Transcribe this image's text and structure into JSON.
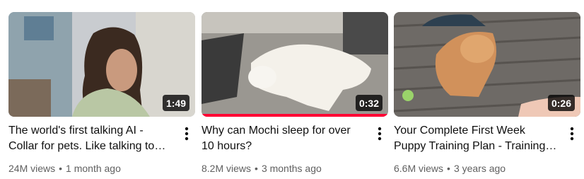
{
  "videos": [
    {
      "title": "The world's first talking AI - Collar for pets. Like talking to your pet",
      "duration": "1:49",
      "views": "24M views",
      "age": "1 month ago",
      "watched_fraction": 0
    },
    {
      "title": "Why can Mochi sleep for over 10 hours?",
      "duration": "0:32",
      "views": "8.2M views",
      "age": "3 months ago",
      "watched_fraction": 1
    },
    {
      "title": "Your Complete First Week Puppy Training Plan - Training your puppy",
      "duration": "0:26",
      "views": "6.6M views",
      "age": "3 years ago",
      "watched_fraction": 0
    }
  ],
  "meta_separator": "•",
  "colors": {
    "progress": "#ff0033",
    "meta_text": "#606060",
    "title_text": "#0f0f0f"
  },
  "icons": {
    "more": "more-vert-icon"
  }
}
